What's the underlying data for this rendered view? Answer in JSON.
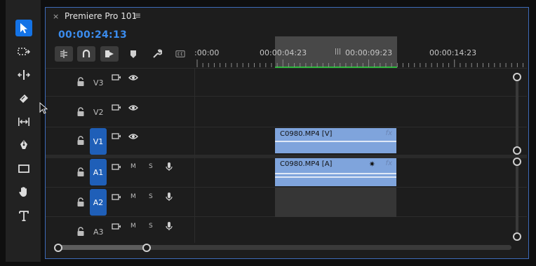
{
  "panel": {
    "title": "Premiere Pro 101",
    "close_glyph": "×",
    "menu_glyph": "≡"
  },
  "playhead": {
    "timecode": "00:00:24:13"
  },
  "ruler": {
    "labels": [
      ":00:00",
      "00:00:04:23",
      "00:00:09:23",
      "00:00:14:23"
    ]
  },
  "tools": [
    {
      "name": "selection-tool-icon",
      "active": true
    },
    {
      "name": "track-select-tool-icon"
    },
    {
      "name": "ripple-edit-tool-icon"
    },
    {
      "name": "razor-tool-icon"
    },
    {
      "name": "slip-tool-icon"
    },
    {
      "name": "pen-tool-icon"
    },
    {
      "name": "rectangle-tool-icon"
    },
    {
      "name": "hand-tool-icon"
    },
    {
      "name": "type-tool-icon"
    }
  ],
  "tracks": {
    "video": [
      "V3",
      "V2",
      "V1"
    ],
    "audio": [
      "A1",
      "A2",
      "A3"
    ],
    "mute_label": "M",
    "solo_label": "S"
  },
  "clips": {
    "video": {
      "label": "C0980.MP4 [V]",
      "fx": "fx"
    },
    "audio": {
      "label": "C0980.MP4 [A]",
      "fx": "fx",
      "badge": "✷"
    }
  },
  "colors": {
    "accent": "#3b8ced",
    "clip": "#7fa4dc",
    "work_area_bar": "#2dbb3d",
    "track_target": "#1f5fb8"
  }
}
